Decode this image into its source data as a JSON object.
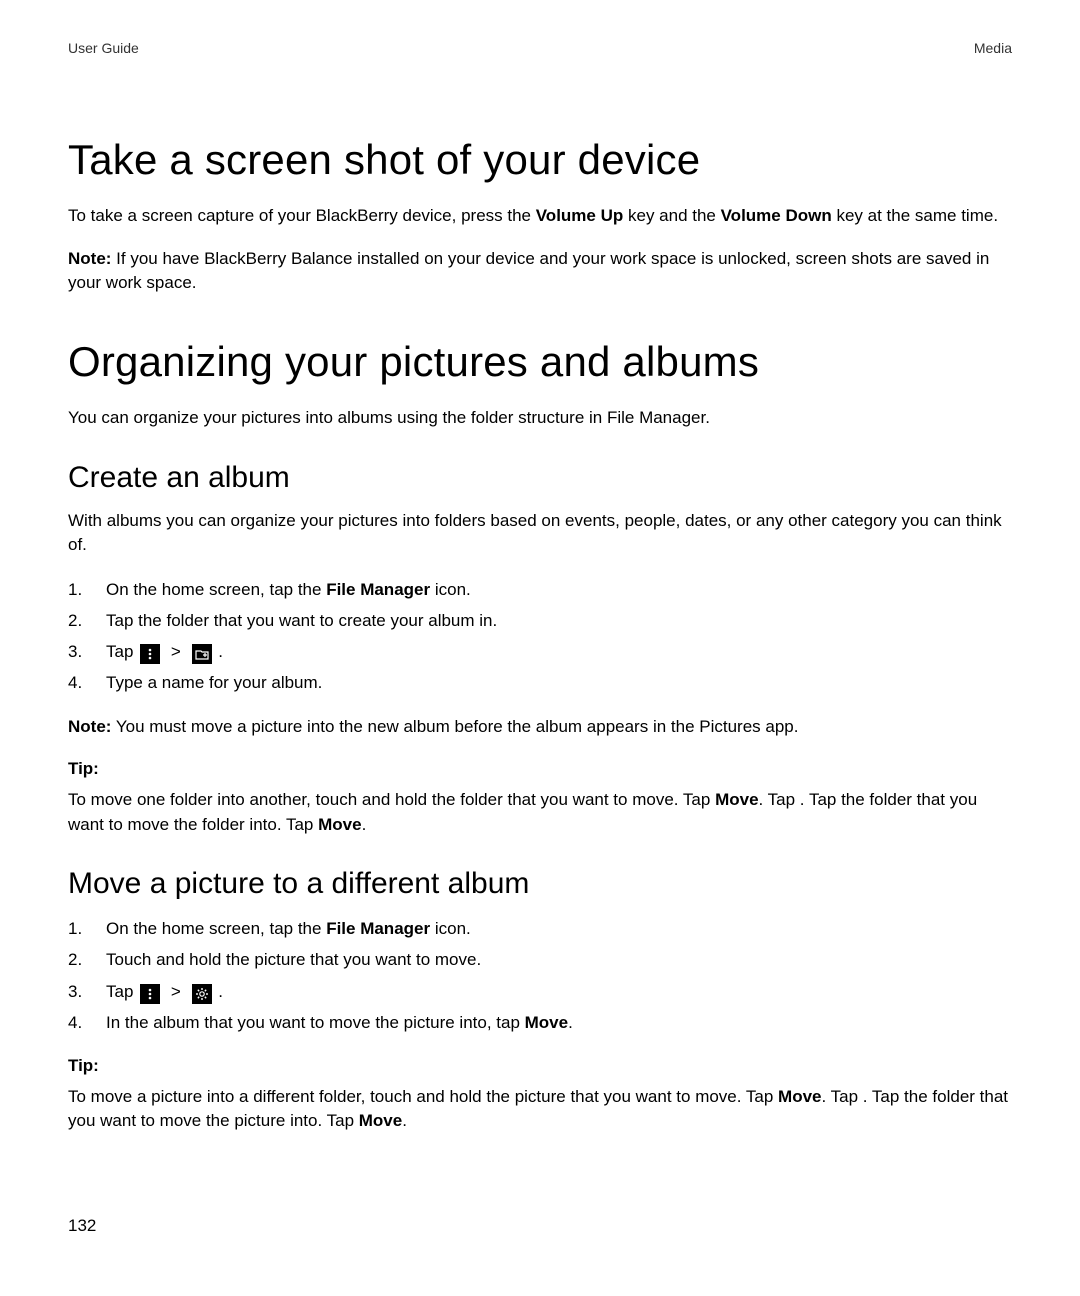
{
  "header": {
    "left": "User Guide",
    "right": "Media"
  },
  "page_number": "132",
  "section1": {
    "title": "Take a screen shot of your device",
    "para1_a": "To take a screen capture of your BlackBerry device, press the ",
    "para1_bold1": "Volume Up",
    "para1_b": " key and the ",
    "para1_bold2": "Volume Down",
    "para1_c": " key at the same time.",
    "note_label": "Note:",
    "note_text": " If you have BlackBerry Balance installed on your device and your work space is unlocked, screen shots are saved in your work space."
  },
  "section2": {
    "title": "Organizing your pictures and albums",
    "intro": "You can organize your pictures into albums using the folder structure in File Manager.",
    "sub1": {
      "title": "Create an album",
      "intro": "With albums you can organize your pictures into folders based on events, people, dates, or any other category you can think of.",
      "steps": {
        "s1_a": "On the home screen, tap the ",
        "s1_bold": "File Manager",
        "s1_b": " icon.",
        "s2": "Tap the folder that you want to create your album in.",
        "s3_a": "Tap ",
        "s3_sep": ">",
        "s3_b": ".",
        "s4": "Type a name for your album."
      },
      "note_label": "Note:",
      "note_text": " You must move a picture into the new album before the album appears in the Pictures app.",
      "tip_label": "Tip:",
      "tip_a": "To move one folder into another, touch and hold the folder that you want to move. Tap ",
      "tip_bold1": "Move",
      "tip_b": ". Tap       . Tap the folder that you want to move the folder into. Tap ",
      "tip_bold2": "Move",
      "tip_c": "."
    },
    "sub2": {
      "title": "Move a picture to a different album",
      "steps": {
        "s1_a": "On the home screen, tap the ",
        "s1_bold": "File Manager",
        "s1_b": " icon.",
        "s2": "Touch and hold the picture that you want to move.",
        "s3_a": "Tap ",
        "s3_sep": ">",
        "s3_b": ".",
        "s4_a": "In the album that you want to move the picture into, tap ",
        "s4_bold": "Move",
        "s4_b": "."
      },
      "tip_label": "Tip:",
      "tip_a": "To move a picture into a different folder, touch and hold the picture that you want to move. Tap ",
      "tip_bold1": "Move",
      "tip_b": ". Tap       . Tap the folder that you want to move the picture into. Tap ",
      "tip_bold2": "Move",
      "tip_c": "."
    }
  },
  "icons": {
    "more": "more-vertical-icon",
    "add_folder": "add-folder-icon",
    "gear": "gear-icon"
  }
}
